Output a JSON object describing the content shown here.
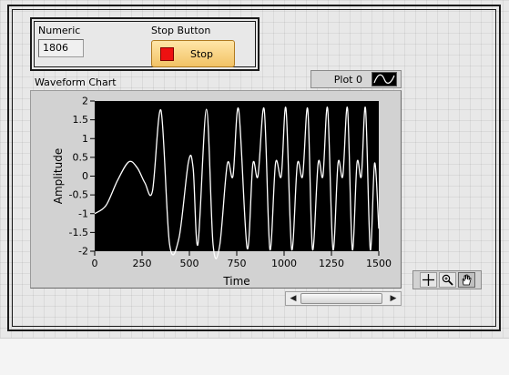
{
  "numeric": {
    "label": "Numeric",
    "value": "1806"
  },
  "stop_button": {
    "label": "Stop Button",
    "text": "Stop"
  },
  "chart": {
    "label": "Waveform Chart",
    "legend_label": "Plot 0"
  },
  "chart_data": {
    "type": "line",
    "xlabel": "Time",
    "ylabel": "Amplitude",
    "xlim": [
      0,
      1500
    ],
    "ylim": [
      -2,
      2
    ],
    "x_ticks": [
      "0",
      "250",
      "500",
      "750",
      "1000",
      "1250",
      "1500"
    ],
    "y_ticks": [
      "2",
      "1.5",
      "1",
      "0.5",
      "0",
      "-0.5",
      "-1",
      "-1.5",
      "-2"
    ],
    "series": [
      {
        "name": "Plot 0",
        "color": "#ffffff",
        "x": [
          0,
          60,
          120,
          180,
          225,
          265,
          305,
          350,
          395,
          445,
          495,
          520,
          545,
          590,
          625,
          660,
          700,
          730,
          760,
          805,
          835,
          862,
          895,
          925,
          955,
          985,
          1010,
          1040,
          1070,
          1098,
          1125,
          1150,
          1180,
          1205,
          1230,
          1258,
          1285,
          1310,
          1335,
          1360,
          1385,
          1408,
          1430,
          1455,
          1478,
          1500
        ],
        "values": [
          -1.0,
          -0.78,
          -0.12,
          0.38,
          0.22,
          -0.18,
          -0.4,
          1.75,
          -1.8,
          -1.65,
          0.38,
          0.2,
          -1.82,
          1.78,
          -1.82,
          -1.85,
          0.32,
          0.0,
          1.78,
          -1.92,
          0.32,
          0.0,
          1.78,
          -1.95,
          0.35,
          0.0,
          1.8,
          -1.95,
          0.32,
          0.0,
          1.78,
          -1.95,
          0.35,
          0.0,
          1.8,
          -1.95,
          0.35,
          0.0,
          1.8,
          -1.95,
          0.35,
          0.0,
          1.8,
          -1.95,
          0.35,
          -1.4
        ]
      }
    ],
    "grid": false
  },
  "tools": [
    "cursor-move-icon",
    "zoom-icon",
    "pan-hand-icon"
  ]
}
